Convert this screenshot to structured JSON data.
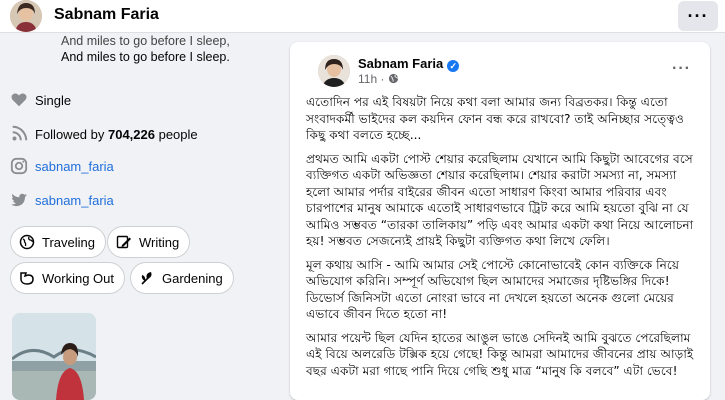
{
  "header": {
    "name": "Sabnam Faria",
    "more_label": "···"
  },
  "intro": {
    "poem_line1": "And miles to go before I sleep,",
    "poem_line2": "And miles to go before I sleep."
  },
  "details": {
    "relationship": "Single",
    "followed_by_prefix": "Followed by ",
    "followers_count": "704,226",
    "followed_by_suffix": " people",
    "instagram": "sabnam_faria",
    "twitter": "sabnam_faria"
  },
  "hobbies": [
    "Traveling",
    "Writing",
    "Working Out",
    "Gardening"
  ],
  "post": {
    "author": "Sabnam Faria",
    "time": "11h",
    "separator": "·",
    "more_label": "···",
    "paragraphs": [
      "এতোদিন পর এই বিষয়টা নিয়ে কথা বলা আমার জন্য বিব্রতকর। কিন্তু এতো সংবাদকর্মী ভাইদের কল কয়দিন ফোন বন্ধ করে রাখবো? তাই অনিচ্ছার সত্ত্বেও কিছু কথা বলতে হচ্ছে...",
      "প্রথমত আমি একটা পোস্ট শেয়ার করেছিলাম যেখানে আমি কিছুটা আবেগের বসে ব্যক্তিগত একটা অভিজ্ঞতা শেয়ার করেছিলাম। শেয়ার করাটা সমস্যা না, সমস্যা হলো আমার পর্দার বাইরের জীবন এতো সাধারণ কিংবা আমার পরিবার এবং চারপাশের মানুষ আমাকে এতোই সাধারণভাবে ট্রিট করে আমি হয়তো বুঝি না যে আমিও সম্ভবত “তারকা তালিকায়” পড়ি এবং আমার একটা কথা নিয়ে আলোচনা হয়! সম্ভবত সেজন্যেই প্রায়ই কিছুটা ব্যক্তিগত কথা লিখে ফেলি।",
      "মূল কথায় আসি - আমি আমার সেই পোস্টে কোনোভাবেই কোন ব্যক্তিকে নিয়ে অভিযোগ করিনি। সম্পূর্ণ অভিযোগ ছিল আমাদের সমাজের দৃষ্টিভঙ্গির দিকে! ডিভোর্স জিনিসটা এতো নোংরা ভাবে না দেখলে হয়তো অনেক গুলো মেয়ের এভাবে জীবন দিতে হতো না!",
      "আমার পয়েন্ট ছিল যেদিন হাতের আঙুল ভাঙে সেদিনই আমি বুঝতে পেরেছিলাম এই বিয়ে অলরেডি টক্সিক হয়ে গেছে! কিন্তু আমরা আমাদের জীবনের প্রায় আড়াই বছর একটা মরা গাছে পানি দিয়ে গেছি শুধু মাত্র “মানুষ কি বলবে” এটা ভেবে!"
    ]
  },
  "colors": {
    "link": "#216fdb",
    "verified": "#1877f2",
    "page_bg": "#f0f2f5"
  }
}
